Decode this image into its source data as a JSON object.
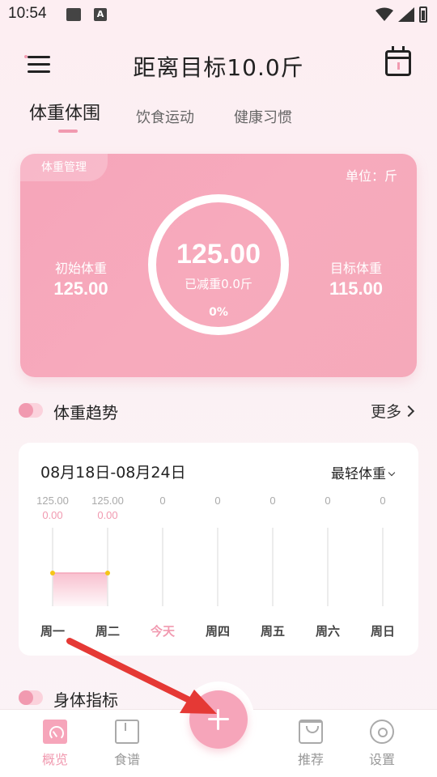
{
  "status_bar": {
    "time": "10:54"
  },
  "header": {
    "title": "距离目标10.0斤"
  },
  "tabs": [
    {
      "label": "体重体围",
      "active": true
    },
    {
      "label": "饮食运动",
      "active": false
    },
    {
      "label": "健康习惯",
      "active": false
    }
  ],
  "weight_card": {
    "tag": "体重管理",
    "unit": "单位：斤",
    "current": "125.00",
    "lost": "已减重0.0斤",
    "percent": "0%",
    "initial_label": "初始体重",
    "initial_value": "125.00",
    "target_label": "目标体重",
    "target_value": "115.00"
  },
  "trend_section": {
    "title": "体重趋势",
    "more": "更多"
  },
  "chart": {
    "date_range": "08月18日-08月24日",
    "filter": "最轻体重"
  },
  "chart_data": {
    "type": "line",
    "categories": [
      "周一",
      "周二",
      "今天",
      "周四",
      "周五",
      "周六",
      "周日"
    ],
    "highlight_category": "今天",
    "series": [
      {
        "values": [
          "125.00",
          "125.00",
          "0",
          "0",
          "0",
          "0",
          "0"
        ]
      },
      {
        "values": [
          "0.00",
          "0.00",
          "",
          "",
          "",
          "",
          ""
        ]
      }
    ]
  },
  "body_section": {
    "title": "身体指标"
  },
  "bottom_nav": {
    "items": [
      {
        "label": "概览",
        "active": true
      },
      {
        "label": "食谱",
        "active": false
      },
      {
        "label": "推荐",
        "active": false
      },
      {
        "label": "设置",
        "active": false
      }
    ]
  },
  "colors": {
    "accent": "#f19ab0",
    "card": "#f6a5ba",
    "arrow": "#e53935"
  }
}
